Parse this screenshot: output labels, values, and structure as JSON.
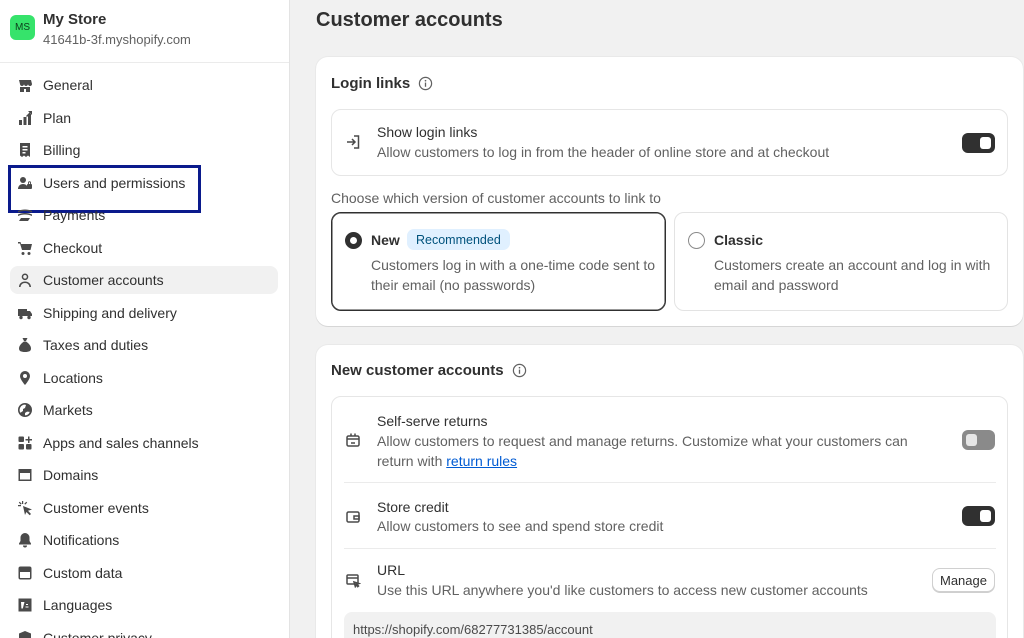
{
  "store": {
    "initials": "MS",
    "name": "My Store",
    "domain": "41641b-3f.myshopify.com"
  },
  "sidebar": {
    "items": [
      {
        "label": "General",
        "icon": "store-icon"
      },
      {
        "label": "Plan",
        "icon": "plan-chart-icon"
      },
      {
        "label": "Billing",
        "icon": "receipt-icon"
      },
      {
        "label": "Users and permissions",
        "icon": "users-icon"
      },
      {
        "label": "Payments",
        "icon": "payments-icon"
      },
      {
        "label": "Checkout",
        "icon": "cart-icon"
      },
      {
        "label": "Customer accounts",
        "icon": "person-icon"
      },
      {
        "label": "Shipping and delivery",
        "icon": "truck-icon"
      },
      {
        "label": "Taxes and duties",
        "icon": "tax-bag-icon"
      },
      {
        "label": "Locations",
        "icon": "location-pin-icon"
      },
      {
        "label": "Markets",
        "icon": "globe-icon"
      },
      {
        "label": "Apps and sales channels",
        "icon": "apps-icon"
      },
      {
        "label": "Domains",
        "icon": "domains-icon"
      },
      {
        "label": "Customer events",
        "icon": "cursor-click-icon"
      },
      {
        "label": "Notifications",
        "icon": "bell-icon"
      },
      {
        "label": "Custom data",
        "icon": "database-icon"
      },
      {
        "label": "Languages",
        "icon": "language-icon"
      },
      {
        "label": "Customer privacy",
        "icon": "privacy-icon"
      }
    ]
  },
  "main": {
    "title": "Customer accounts",
    "login_links": {
      "title": "Login links",
      "show_title": "Show login links",
      "show_desc": "Allow customers to log in from the header of online store and at checkout",
      "show_enabled": true,
      "choose_label": "Choose which version of customer accounts to link to",
      "options": {
        "new": {
          "title": "New",
          "badge": "Recommended",
          "desc": "Customers log in with a one-time code sent to their email (no passwords)",
          "selected": true
        },
        "classic": {
          "title": "Classic",
          "desc": "Customers create an account and log in with email and password",
          "selected": false
        }
      }
    },
    "new_accounts": {
      "title": "New customer accounts",
      "returns": {
        "title": "Self-serve returns",
        "desc": "Allow customers to request and manage returns. Customize what your customers can return with",
        "link": "return rules",
        "enabled": false
      },
      "store_credit": {
        "title": "Store credit",
        "desc": "Allow customers to see and spend store credit",
        "enabled": true
      },
      "url": {
        "title": "URL",
        "desc": "Use this URL anywhere you'd like customers to access new customer accounts",
        "manage_label": "Manage",
        "value": "https://shopify.com/68277731385/account"
      }
    }
  },
  "colors": {
    "accent_toggle": "#303030",
    "link": "#005bd3",
    "highlight_box": "#0a1a8c",
    "avatar": "#36e36b",
    "badge_bg": "#e0f0ff"
  }
}
